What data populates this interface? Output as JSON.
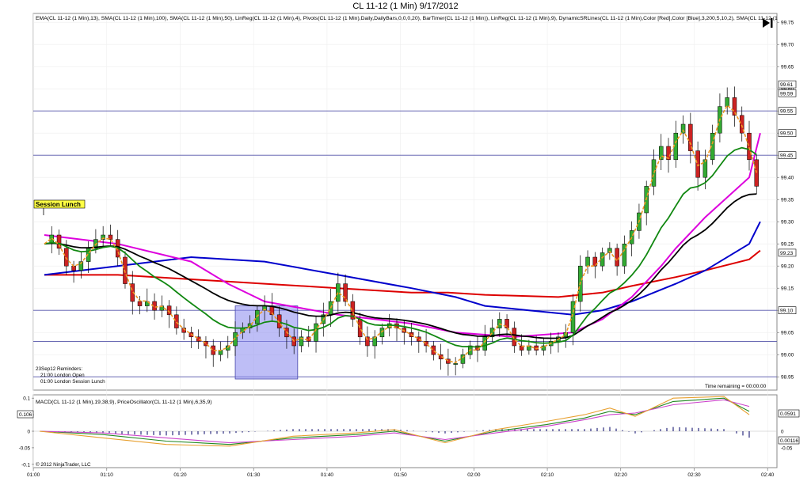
{
  "window": {
    "title": "CL 11-12 (1 Min)  9/17/2012"
  },
  "main_panel": {
    "indicator_header": "EMA(CL 11-12 (1 Min),13), SMA(CL 11-12 (1 Min),100), SMA(CL 11-12 (1 Min),50), LinReg(CL 11-12 (1 Min),4), Pivots(CL 11-12 (1 Min),Daily,DailyBars,0,0,0,20), BarTimer(CL 11-12 (1 Min)), LinReg(CL 11-12 (1 Min),9), DynamicSRLines(CL 11-12 (1 Min),Color [Red],Color [Blue],3,200,5,10,2), SMA(CL 11-12 (1",
    "session_label": "Session Lunch",
    "reminders": [
      "23Sep12 Reminders:",
      "21:00 London Open",
      "01:00 London Session Lunch"
    ],
    "time_remaining": "Time remaining = 00:00:00",
    "price_markers": [
      "99.61",
      "99.59",
      "99.55",
      "99.50",
      "99.45",
      "99.23",
      "99.10"
    ]
  },
  "macd_panel": {
    "header": "MACD(CL 11-12 (1 Min),19,38,9), PriceOscillator(CL 11-12 (1 Min),6,35,9)",
    "left_marker": "0.106",
    "right_markers": [
      "0.0591",
      "0.00116"
    ],
    "copyright": "© 2012 NinjaTrader, LLC"
  },
  "chart_data": [
    {
      "type": "candlestick",
      "title": "CL 11-12 (1 Min)  9/17/2012",
      "x_tick_labels": [
        "01:00",
        "01:10",
        "01:20",
        "01:30",
        "01:40",
        "01:50",
        "02:00",
        "02:10",
        "02:20",
        "02:30",
        "02:40",
        "02:50",
        "03:00",
        "03:10",
        "03:20",
        "03:30",
        "03:40"
      ],
      "y_tick_labels": [
        "99.75",
        "99.70",
        "99.65",
        "99.60",
        "99.55",
        "99.50",
        "99.45",
        "99.40",
        "99.35",
        "99.30",
        "99.25",
        "99.20",
        "99.15",
        "99.10",
        "99.05",
        "99.00",
        "98.95"
      ],
      "ylim": [
        98.92,
        99.77
      ],
      "x_minutes_range": [
        -2,
        98
      ],
      "horizontal_lines": [
        99.55,
        99.45,
        99.1,
        99.03,
        98.95
      ],
      "highlight_box": {
        "x0": 26,
        "x1": 34.5,
        "y0": 98.945,
        "y1": 99.11
      },
      "price_path": [
        [
          0,
          99.25
        ],
        [
          1,
          99.27
        ],
        [
          2,
          99.24
        ],
        [
          3,
          99.2
        ],
        [
          4,
          99.19
        ],
        [
          5,
          99.21
        ],
        [
          6,
          99.24
        ],
        [
          7,
          99.26
        ],
        [
          8,
          99.27
        ],
        [
          9,
          99.26
        ],
        [
          10,
          99.22
        ],
        [
          11,
          99.16
        ],
        [
          12,
          99.12
        ],
        [
          13,
          99.11
        ],
        [
          14,
          99.12
        ],
        [
          15,
          99.1
        ],
        [
          16,
          99.11
        ],
        [
          17,
          99.09
        ],
        [
          18,
          99.06
        ],
        [
          19,
          99.05
        ],
        [
          20,
          99.04
        ],
        [
          21,
          99.03
        ],
        [
          22,
          99.02
        ],
        [
          23,
          99.0
        ],
        [
          24,
          99.01
        ],
        [
          25,
          99.02
        ],
        [
          26,
          99.05
        ],
        [
          27,
          99.06
        ],
        [
          28,
          99.07
        ],
        [
          29,
          99.1
        ],
        [
          30,
          99.11
        ],
        [
          31,
          99.09
        ],
        [
          32,
          99.06
        ],
        [
          33,
          99.04
        ],
        [
          34,
          99.02
        ],
        [
          35,
          99.04
        ],
        [
          36,
          99.03
        ],
        [
          37,
          99.07
        ],
        [
          38,
          99.09
        ],
        [
          39,
          99.12
        ],
        [
          40,
          99.16
        ],
        [
          41,
          99.12
        ],
        [
          42,
          99.08
        ],
        [
          43,
          99.04
        ],
        [
          44,
          99.02
        ],
        [
          45,
          99.04
        ],
        [
          46,
          99.06
        ],
        [
          47,
          99.07
        ],
        [
          48,
          99.06
        ],
        [
          49,
          99.05
        ],
        [
          50,
          99.04
        ],
        [
          51,
          99.03
        ],
        [
          52,
          99.02
        ],
        [
          53,
          99.0
        ],
        [
          54,
          98.99
        ],
        [
          55,
          98.98
        ],
        [
          56,
          98.98
        ],
        [
          57,
          99.0
        ],
        [
          58,
          99.02
        ],
        [
          59,
          99.01
        ],
        [
          60,
          99.04
        ],
        [
          61,
          99.06
        ],
        [
          62,
          99.08
        ],
        [
          63,
          99.06
        ],
        [
          64,
          99.02
        ],
        [
          65,
          99.01
        ],
        [
          66,
          99.02
        ],
        [
          67,
          99.01
        ],
        [
          68,
          99.02
        ],
        [
          69,
          99.03
        ],
        [
          70,
          99.04
        ],
        [
          71,
          99.05
        ],
        [
          72,
          99.12
        ],
        [
          73,
          99.2
        ],
        [
          74,
          99.22
        ],
        [
          75,
          99.2
        ],
        [
          76,
          99.23
        ],
        [
          77,
          99.24
        ],
        [
          78,
          99.2
        ],
        [
          79,
          99.25
        ],
        [
          80,
          99.28
        ],
        [
          81,
          99.32
        ],
        [
          82,
          99.38
        ],
        [
          83,
          99.44
        ],
        [
          84,
          99.47
        ],
        [
          85,
          99.44
        ],
        [
          86,
          99.5
        ],
        [
          87,
          99.52
        ],
        [
          88,
          99.46
        ],
        [
          89,
          99.4
        ],
        [
          90,
          99.44
        ],
        [
          91,
          99.5
        ],
        [
          92,
          99.56
        ],
        [
          93,
          99.58
        ],
        [
          94,
          99.54
        ],
        [
          95,
          99.5
        ],
        [
          96,
          99.44
        ],
        [
          97,
          99.38
        ]
      ],
      "series": [
        {
          "name": "SMA(CL 11-12 (1 Min),100)",
          "color": "#dd0000",
          "points": [
            [
              0,
              99.18
            ],
            [
              10,
              99.18
            ],
            [
              20,
              99.17
            ],
            [
              30,
              99.16
            ],
            [
              40,
              99.15
            ],
            [
              50,
              99.14
            ],
            [
              55,
              99.14
            ],
            [
              60,
              99.135
            ],
            [
              70,
              99.13
            ],
            [
              76,
              99.14
            ],
            [
              80,
              99.155
            ],
            [
              86,
              99.175
            ],
            [
              90,
              99.19
            ],
            [
              96,
              99.215
            ],
            [
              100,
              99.235
            ]
          ]
        },
        {
          "name": "SMA(CL 11-12 (1 Min),50)",
          "color": "#0000cc",
          "points": [
            [
              0,
              99.18
            ],
            [
              10,
              99.2
            ],
            [
              20,
              99.22
            ],
            [
              30,
              99.21
            ],
            [
              40,
              99.18
            ],
            [
              50,
              99.15
            ],
            [
              56,
              99.13
            ],
            [
              60,
              99.11
            ],
            [
              66,
              99.1
            ],
            [
              72,
              99.09
            ],
            [
              76,
              99.1
            ],
            [
              80,
              99.12
            ],
            [
              86,
              99.16
            ],
            [
              90,
              99.19
            ],
            [
              96,
              99.25
            ],
            [
              100,
              99.3
            ]
          ]
        },
        {
          "name": "SMA(CL 11-12 (1 Min),20)",
          "color": "#dd00dd",
          "points": [
            [
              0,
              99.27
            ],
            [
              10,
              99.25
            ],
            [
              20,
              99.21
            ],
            [
              25,
              99.16
            ],
            [
              30,
              99.12
            ],
            [
              40,
              99.09
            ],
            [
              50,
              99.07
            ],
            [
              56,
              99.05
            ],
            [
              64,
              99.04
            ],
            [
              72,
              99.05
            ],
            [
              76,
              99.08
            ],
            [
              80,
              99.13
            ],
            [
              84,
              99.2
            ],
            [
              86,
              99.24
            ],
            [
              90,
              99.31
            ],
            [
              96,
              99.4
            ],
            [
              100,
              99.5
            ]
          ]
        }
      ],
      "y_label_text": [
        "99.75",
        "99.70",
        "99.65",
        "99.60",
        "99.55",
        "99.50",
        "99.45",
        "99.40",
        "99.35",
        "99.30",
        "99.25",
        "99.20",
        "99.15",
        "99.10",
        "99.05",
        "99.00",
        "98.95"
      ]
    },
    {
      "type": "line",
      "title": "MACD(CL 11-12 (1 Min),19,38,9), PriceOscillator(CL 11-12 (1 Min),6,35,9)",
      "y_tick_labels": [
        "0.1",
        "0.05",
        "0",
        "-0.05",
        "-0.1"
      ],
      "ylim": [
        -0.11,
        0.11
      ],
      "series": [
        {
          "name": "MACD",
          "color": "#228822",
          "points": [
            [
              0,
              0.0
            ],
            [
              10,
              -0.01
            ],
            [
              20,
              -0.03
            ],
            [
              30,
              -0.04
            ],
            [
              40,
              -0.02
            ],
            [
              50,
              -0.01
            ],
            [
              56,
              0.0
            ],
            [
              64,
              -0.03
            ],
            [
              72,
              0.0
            ],
            [
              80,
              0.02
            ],
            [
              86,
              0.04
            ],
            [
              90,
              0.06
            ],
            [
              94,
              0.05
            ],
            [
              100,
              0.09
            ],
            [
              108,
              0.1
            ],
            [
              112,
              0.06
            ]
          ]
        },
        {
          "name": "Signal",
          "color": "#cc44cc",
          "points": [
            [
              0,
              0.0
            ],
            [
              10,
              -0.005
            ],
            [
              20,
              -0.02
            ],
            [
              30,
              -0.035
            ],
            [
              40,
              -0.025
            ],
            [
              50,
              -0.015
            ],
            [
              56,
              -0.005
            ],
            [
              64,
              -0.025
            ],
            [
              72,
              -0.005
            ],
            [
              80,
              0.015
            ],
            [
              86,
              0.035
            ],
            [
              90,
              0.05
            ],
            [
              94,
              0.055
            ],
            [
              100,
              0.08
            ],
            [
              108,
              0.095
            ],
            [
              112,
              0.075
            ]
          ]
        },
        {
          "name": "PriceOscillator",
          "color": "#e8a030",
          "points": [
            [
              0,
              0.0
            ],
            [
              10,
              -0.02
            ],
            [
              20,
              -0.04
            ],
            [
              30,
              -0.045
            ],
            [
              40,
              -0.015
            ],
            [
              50,
              -0.005
            ],
            [
              56,
              0.005
            ],
            [
              64,
              -0.035
            ],
            [
              72,
              0.005
            ],
            [
              80,
              0.03
            ],
            [
              86,
              0.05
            ],
            [
              90,
              0.07
            ],
            [
              94,
              0.045
            ],
            [
              100,
              0.1
            ],
            [
              108,
              0.105
            ],
            [
              112,
              0.05
            ]
          ]
        }
      ]
    }
  ]
}
